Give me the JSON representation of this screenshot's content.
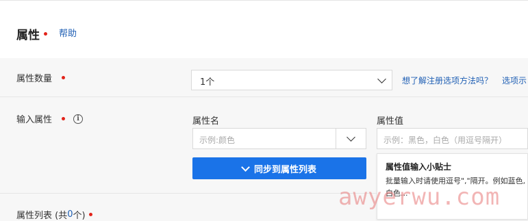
{
  "header": {
    "title": "属性",
    "help_link": "帮助"
  },
  "attr_count": {
    "label": "属性数量",
    "value": "1个",
    "hint_link": "想了解注册选项方法吗？",
    "hint_link2": "选项示"
  },
  "input_attrs": {
    "label": "输入属性",
    "name_col_label": "属性名",
    "name_placeholder": "示例:颜色",
    "value_col_label": "属性值",
    "value_placeholder": "示例：黑色，白色（用逗号隔开）",
    "sync_button": "同步到属性列表"
  },
  "tip": {
    "title": "属性值输入小贴士",
    "body": "批量输入时请使用逗号\",\"隔开。例如蓝色,白色..."
  },
  "attr_list": {
    "label_prefix": "属性列表 (共 ",
    "count": "0",
    "label_suffix": " 个)"
  },
  "watermark": "awyerwu.com",
  "colors": {
    "accent_blue": "#1a73e8",
    "link_blue": "#1f5fb4",
    "required_red": "#e2231a"
  }
}
